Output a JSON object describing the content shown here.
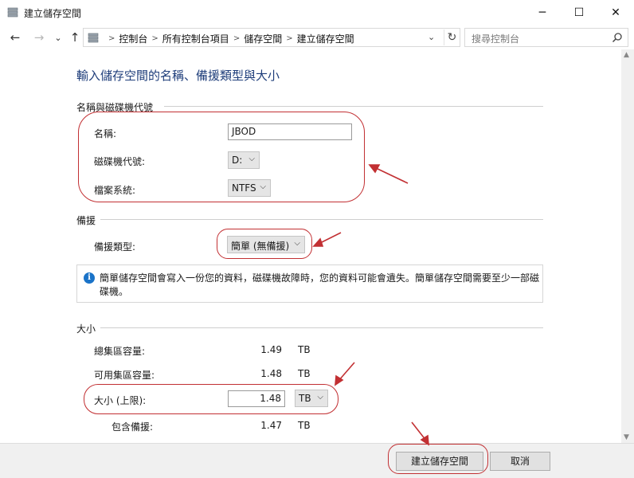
{
  "window": {
    "title": "建立儲存空間",
    "minimize_glyph": "─",
    "maximize_glyph": "☐",
    "close_glyph": "✕"
  },
  "nav": {
    "back_glyph": "←",
    "forward_glyph": "→",
    "recent_glyph": "⌄",
    "up_glyph": "↑",
    "breadcrumbs": [
      "控制台",
      "所有控制台項目",
      "儲存空間",
      "建立儲存空間"
    ],
    "separator": ">",
    "dropdown_glyph": "⌄",
    "refresh_glyph": "↻",
    "search_placeholder": "搜尋控制台"
  },
  "page": {
    "heading": "輸入儲存空間的名稱、備援類型與大小"
  },
  "name_section": {
    "title": "名稱與磁碟機代號",
    "name_label": "名稱:",
    "name_value": "JBOD",
    "drive_label": "磁碟機代號:",
    "drive_value": "D:",
    "fs_label": "檔案系統:",
    "fs_value": "NTFS"
  },
  "resiliency_section": {
    "title": "備援",
    "type_label": "備援類型:",
    "type_value": "簡單 (無備援)",
    "info_text": "簡單儲存空間會寫入一份您的資料，磁碟機故障時，您的資料可能會遺失。簡單儲存空間需要至少一部磁碟機。"
  },
  "size_section": {
    "title": "大小",
    "rows": [
      {
        "label": "總集區容量:",
        "value": "1.49",
        "unit": "TB"
      },
      {
        "label": "可用集區容量:",
        "value": "1.48",
        "unit": "TB"
      }
    ],
    "max_label": "大小 (上限):",
    "max_value": "1.48",
    "max_unit": "TB",
    "incl_label": "包含備援:",
    "incl_value": "1.47",
    "incl_unit": "TB"
  },
  "footer": {
    "create_label": "建立儲存空間",
    "cancel_label": "取消"
  },
  "colors": {
    "heading": "#1e3d7a",
    "annotation": "#c23033",
    "info_icon": "#1a73c8"
  },
  "icons": {
    "app": "storage-spaces-icon",
    "search": "search-icon",
    "info": "info-icon",
    "chevron": "chevron-down-icon"
  }
}
